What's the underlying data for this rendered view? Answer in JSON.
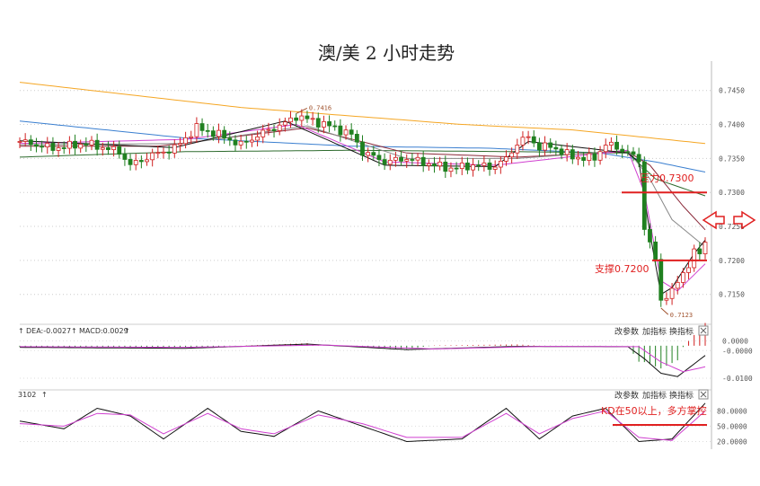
{
  "chart_data": {
    "type": "candlestick",
    "title": "澳/美 2 小时走势",
    "price_panel": {
      "ylim": [
        0.711,
        0.748
      ],
      "y_ticks": [
        "0.7450",
        "0.7400",
        "0.7350",
        "0.7300",
        "0.7250",
        "0.7200",
        "0.7150"
      ],
      "y_tick_values": [
        0.745,
        0.74,
        0.735,
        0.73,
        0.725,
        0.72,
        0.715
      ],
      "n_bars": 125,
      "close_path": [
        [
          0,
          0.7375
        ],
        [
          6,
          0.7365
        ],
        [
          12,
          0.7372
        ],
        [
          18,
          0.736
        ],
        [
          20,
          0.734
        ],
        [
          24,
          0.7355
        ],
        [
          28,
          0.7365
        ],
        [
          32,
          0.7395
        ],
        [
          36,
          0.7385
        ],
        [
          40,
          0.737
        ],
        [
          44,
          0.7388
        ],
        [
          48,
          0.7402
        ],
        [
          50,
          0.7412
        ],
        [
          52,
          0.7408
        ],
        [
          56,
          0.7398
        ],
        [
          60,
          0.7385
        ],
        [
          62,
          0.736
        ],
        [
          66,
          0.7345
        ],
        [
          70,
          0.735
        ],
        [
          74,
          0.7342
        ],
        [
          78,
          0.7335
        ],
        [
          82,
          0.734
        ],
        [
          86,
          0.7338
        ],
        [
          88,
          0.735
        ],
        [
          90,
          0.7372
        ],
        [
          92,
          0.7382
        ],
        [
          94,
          0.7366
        ],
        [
          96,
          0.7368
        ],
        [
          100,
          0.7352
        ],
        [
          104,
          0.735
        ],
        [
          106,
          0.7372
        ],
        [
          108,
          0.7365
        ],
        [
          110,
          0.736
        ],
        [
          112,
          0.7345
        ],
        [
          113,
          0.725
        ],
        [
          115,
          0.72
        ],
        [
          116,
          0.714
        ],
        [
          117,
          0.715
        ],
        [
          118,
          0.7155
        ],
        [
          120,
          0.718
        ],
        [
          122,
          0.7212
        ],
        [
          123,
          0.721
        ],
        [
          124,
          0.7225
        ]
      ],
      "series": [
        {
          "name": "MA-orange",
          "color": "#f5a623",
          "points": [
            [
              0,
              0.7462
            ],
            [
              40,
              0.7425
            ],
            [
              80,
              0.74
            ],
            [
              100,
              0.7392
            ],
            [
              124,
              0.7372
            ]
          ]
        },
        {
          "name": "MA-blue",
          "color": "#3a7fd0",
          "points": [
            [
              0,
              0.7405
            ],
            [
              30,
              0.738
            ],
            [
              60,
              0.7368
            ],
            [
              85,
              0.7365
            ],
            [
              105,
              0.7358
            ],
            [
              115,
              0.7345
            ],
            [
              124,
              0.733
            ]
          ]
        },
        {
          "name": "MA-dkgreen",
          "color": "#2e6b2e",
          "points": [
            [
              0,
              0.7352
            ],
            [
              30,
              0.736
            ],
            [
              60,
              0.7362
            ],
            [
              90,
              0.736
            ],
            [
              110,
              0.7358
            ],
            [
              115,
              0.732
            ],
            [
              124,
              0.7295
            ]
          ]
        },
        {
          "name": "MA-darkred",
          "color": "#8b2a3a",
          "points": [
            [
              0,
              0.7368
            ],
            [
              25,
              0.7368
            ],
            [
              52,
              0.7395
            ],
            [
              70,
              0.7358
            ],
            [
              90,
              0.7352
            ],
            [
              110,
              0.736
            ],
            [
              114,
              0.734
            ],
            [
              120,
              0.728
            ],
            [
              124,
              0.7245
            ]
          ]
        },
        {
          "name": "MA-gray",
          "color": "#888888",
          "points": [
            [
              0,
              0.737
            ],
            [
              30,
              0.7372
            ],
            [
              52,
              0.7398
            ],
            [
              70,
              0.735
            ],
            [
              90,
              0.735
            ],
            [
              110,
              0.7362
            ],
            [
              114,
              0.732
            ],
            [
              118,
              0.726
            ],
            [
              124,
              0.722
            ]
          ]
        },
        {
          "name": "MA-magenta",
          "color": "#d040d0",
          "points": [
            [
              0,
              0.7372
            ],
            [
              30,
              0.7378
            ],
            [
              50,
              0.74
            ],
            [
              66,
              0.7345
            ],
            [
              86,
              0.734
            ],
            [
              110,
              0.7362
            ],
            [
              113,
              0.73
            ],
            [
              116,
              0.717
            ],
            [
              119,
              0.7155
            ],
            [
              124,
              0.7195
            ]
          ]
        },
        {
          "name": "MA-black",
          "color": "#111111",
          "points": [
            [
              0,
              0.7376
            ],
            [
              28,
              0.7366
            ],
            [
              48,
              0.7405
            ],
            [
              66,
              0.734
            ],
            [
              86,
              0.7338
            ],
            [
              92,
              0.7375
            ],
            [
              110,
              0.7358
            ],
            [
              112,
              0.7345
            ],
            [
              114,
              0.724
            ],
            [
              116,
              0.715
            ],
            [
              118,
              0.716
            ],
            [
              122,
              0.721
            ],
            [
              124,
              0.723
            ]
          ]
        }
      ],
      "annotations": {
        "high_label": "0.7416",
        "low_label": "0.7123",
        "resistance_label": "压力0.7300",
        "resistance_value": 0.73,
        "support_label": "支撑0.7200",
        "support_value": 0.72
      }
    },
    "macd_panel": {
      "label": "DEA:-0.0027",
      "label2": "MACD:0.0029",
      "y_ticks": [
        "0.0000",
        "-0.0000",
        "-0.0100"
      ],
      "ylim": [
        -0.0125,
        0.003
      ],
      "dif_points": [
        [
          0,
          -0.0005
        ],
        [
          30,
          -0.0008
        ],
        [
          52,
          0.0005
        ],
        [
          70,
          -0.0012
        ],
        [
          90,
          -0.0002
        ],
        [
          110,
          -0.0003
        ],
        [
          113,
          -0.004
        ],
        [
          116,
          -0.0085
        ],
        [
          119,
          -0.0095
        ],
        [
          124,
          -0.003
        ]
      ],
      "dea_points": [
        [
          0,
          -0.0003
        ],
        [
          30,
          -0.0005
        ],
        [
          55,
          0.0002
        ],
        [
          75,
          -0.001
        ],
        [
          95,
          -0.0002
        ],
        [
          112,
          -0.0003
        ],
        [
          116,
          -0.005
        ],
        [
          120,
          -0.008
        ],
        [
          124,
          -0.0065
        ]
      ]
    },
    "kd_panel": {
      "label": "3102",
      "y_ticks": [
        "80.0000",
        "50.0000",
        "20.0000"
      ],
      "ylim": [
        5,
        100
      ],
      "annotation": "KD在50以上，多方掌控",
      "k_points": [
        [
          0,
          60
        ],
        [
          8,
          45
        ],
        [
          14,
          85
        ],
        [
          20,
          70
        ],
        [
          26,
          25
        ],
        [
          34,
          85
        ],
        [
          40,
          40
        ],
        [
          46,
          30
        ],
        [
          54,
          80
        ],
        [
          62,
          50
        ],
        [
          70,
          20
        ],
        [
          80,
          25
        ],
        [
          88,
          85
        ],
        [
          94,
          25
        ],
        [
          100,
          70
        ],
        [
          106,
          85
        ],
        [
          112,
          20
        ],
        [
          118,
          25
        ],
        [
          124,
          95
        ]
      ],
      "d_points": [
        [
          0,
          55
        ],
        [
          8,
          50
        ],
        [
          14,
          75
        ],
        [
          20,
          72
        ],
        [
          26,
          35
        ],
        [
          34,
          75
        ],
        [
          40,
          45
        ],
        [
          46,
          35
        ],
        [
          54,
          72
        ],
        [
          62,
          55
        ],
        [
          70,
          28
        ],
        [
          80,
          28
        ],
        [
          88,
          75
        ],
        [
          94,
          35
        ],
        [
          100,
          65
        ],
        [
          106,
          80
        ],
        [
          112,
          28
        ],
        [
          118,
          22
        ],
        [
          124,
          80
        ]
      ]
    },
    "buttons": [
      "改参数",
      "加指标",
      "换指标"
    ]
  }
}
